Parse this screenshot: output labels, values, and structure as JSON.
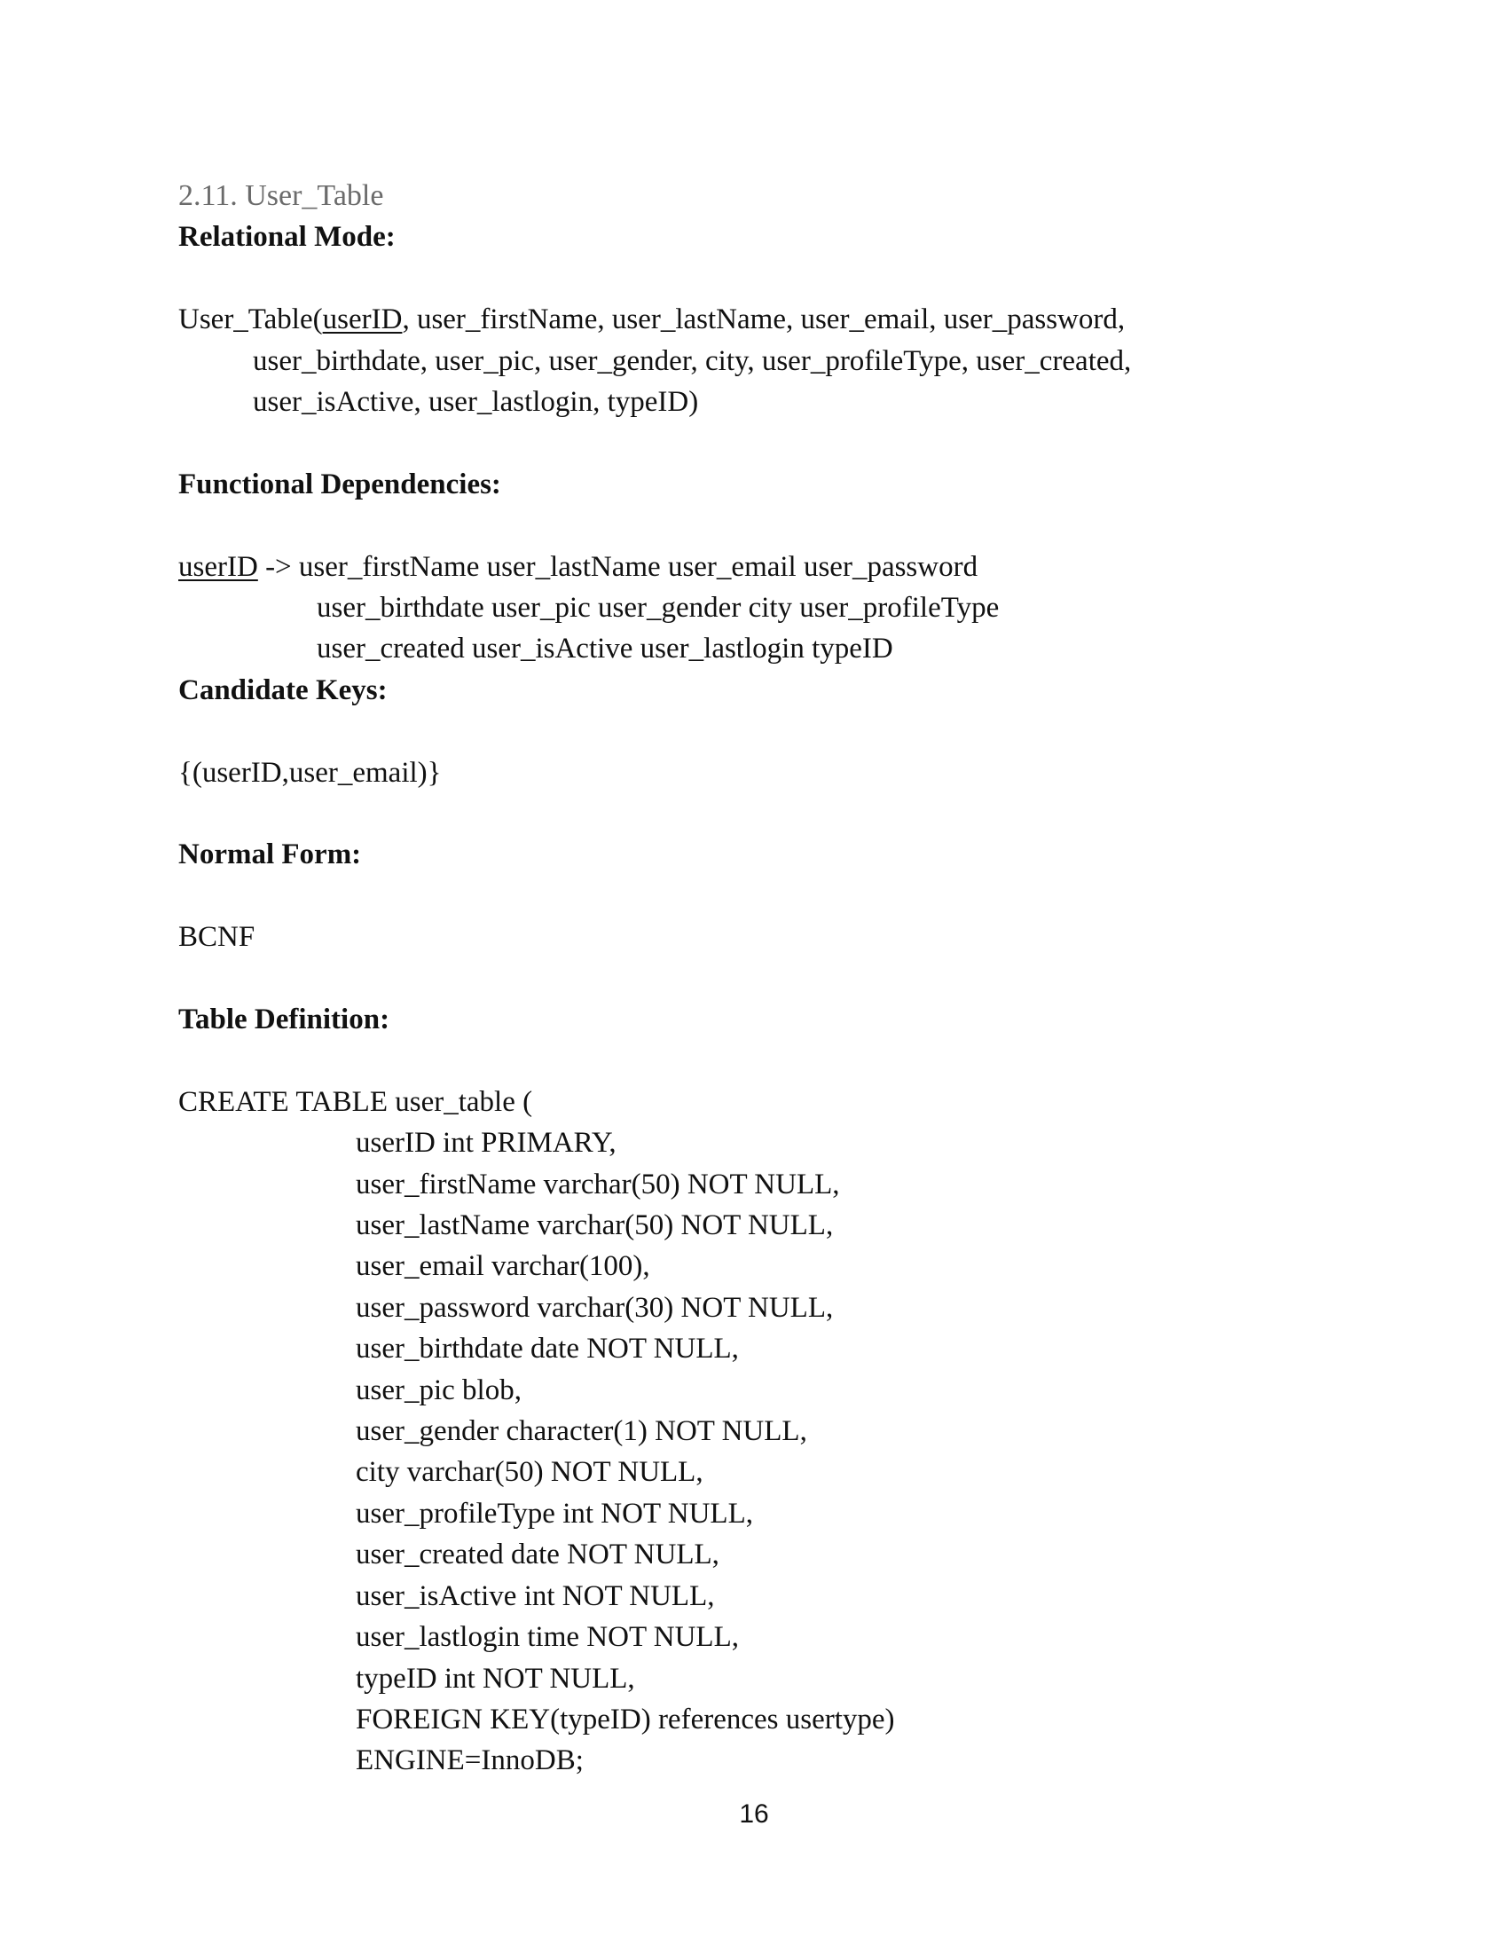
{
  "section": {
    "title": "2.11.  User_Table"
  },
  "relational_mode": {
    "heading": "Relational Mode:",
    "table_name": "User_Table(",
    "key": "userID",
    "rest_line1": ", user_firstName, user_lastName, user_email, user_password,",
    "line2": "user_birthdate, user_pic, user_gender, city, user_profileType, user_created,",
    "line3": "user_isActive, user_lastlogin, typeID)"
  },
  "functional_dependencies": {
    "heading": "Functional Dependencies:",
    "determinant": "userID",
    "arrow_line1": " -> user_firstName user_lastName user_email user_password",
    "line2": "user_birthdate user_pic user_gender city user_profileType",
    "line3": "user_created user_isActive user_lastlogin typeID"
  },
  "candidate_keys": {
    "heading": "Candidate Keys:",
    "value": "{(userID,user_email)}"
  },
  "normal_form": {
    "heading": "Normal Form:",
    "value": "BCNF"
  },
  "table_definition": {
    "heading": "Table Definition:",
    "first_line": "CREATE TABLE user_table (",
    "lines": [
      "userID int PRIMARY,",
      "user_firstName varchar(50) NOT NULL,",
      "user_lastName varchar(50) NOT NULL,",
      "user_email varchar(100),",
      "user_password varchar(30) NOT NULL,",
      "user_birthdate date NOT NULL,",
      "user_pic blob,",
      "user_gender character(1) NOT NULL,",
      "city varchar(50) NOT NULL,",
      "user_profileType int NOT NULL,",
      "user_created date NOT NULL,",
      "user_isActive int NOT NULL,",
      "user_lastlogin time NOT NULL,",
      "typeID int NOT NULL,",
      "FOREIGN KEY(typeID) references usertype)",
      "ENGINE=InnoDB;"
    ]
  },
  "page_number": "16"
}
